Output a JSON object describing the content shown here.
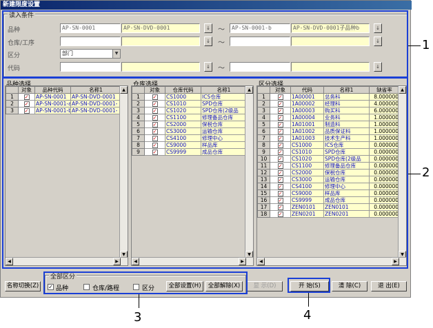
{
  "window": {
    "title": "新建限度设置"
  },
  "input_conditions": {
    "legend": "读入条件",
    "rows": [
      {
        "label": "品种",
        "from_code": "AP-SN-0001",
        "from_name": "AP-SN-DVD-0001",
        "to_code": "AP-SN-0001-b",
        "to_name": "AP-SN-DVD-0001子品种b"
      },
      {
        "label": "仓库/工序",
        "from_code": "",
        "from_name": "",
        "to_code": "",
        "to_name": ""
      },
      {
        "label": "区分",
        "select_value": "部门"
      },
      {
        "label": "代码",
        "from_code": "",
        "from_name": "",
        "to_code": "",
        "to_name": ""
      }
    ],
    "lookup_btn": "↓",
    "tilde": "～"
  },
  "panels": {
    "product": {
      "title": "品种选择",
      "headers": [
        "",
        "对象",
        "品种代码",
        "名称1"
      ],
      "rows": [
        [
          "1",
          "✓",
          "AP-SN-0001",
          "AP-SN-DVD-0001"
        ],
        [
          "2",
          "✓",
          "AP-SN-0001-a",
          "AP-SN-DVD-0001-"
        ],
        [
          "3",
          "✓",
          "AP-SN-0001-b",
          "AP-SN-DVD-0001-"
        ]
      ]
    },
    "warehouse": {
      "title": "仓库选择",
      "headers": [
        "",
        "对象",
        "仓库代码",
        "名称1"
      ],
      "rows": [
        [
          "1",
          "✓",
          "CS1000",
          "ICS仓库"
        ],
        [
          "2",
          "✓",
          "CS1010",
          "SPD仓库"
        ],
        [
          "3",
          "✓",
          "CS1020",
          "SPD仓库(2级品"
        ],
        [
          "4",
          "✓",
          "CS1100",
          "修理备品仓库"
        ],
        [
          "5",
          "✓",
          "CS2000",
          "保税仓库"
        ],
        [
          "6",
          "✓",
          "CS3000",
          "运输仓库"
        ],
        [
          "7",
          "✓",
          "CS4100",
          "修理中心"
        ],
        [
          "8",
          "✓",
          "CS9000",
          "样品库"
        ],
        [
          "9",
          "✓",
          "CS9999",
          "成品仓库"
        ]
      ]
    },
    "category": {
      "title": "区分选择",
      "headers": [
        "",
        "对象",
        "代码",
        "名称1",
        "缺省率"
      ],
      "rows": [
        [
          "1",
          "✓",
          "1A00001",
          "总务科",
          "8.000000"
        ],
        [
          "2",
          "✓",
          "1A00002",
          "经理科",
          "4.000000"
        ],
        [
          "3",
          "✓",
          "1A00003",
          "购买科",
          "6.000000"
        ],
        [
          "4",
          "✓",
          "1A00004",
          "业务科",
          "1.000000"
        ],
        [
          "5",
          "✓",
          "1A01001",
          "制造科",
          "1.000000"
        ],
        [
          "6",
          "✓",
          "1A01002",
          "品质保证科",
          "1.000000"
        ],
        [
          "7",
          "✓",
          "1A01003",
          "技术生产科",
          "1.000000"
        ],
        [
          "8",
          "✓",
          "CS1000",
          "ICS仓库",
          "0.000000"
        ],
        [
          "9",
          "✓",
          "CS1010",
          "SPD仓库",
          "0.000000"
        ],
        [
          "10",
          "✓",
          "CS1020",
          "SPD仓库(2级品",
          "0.000000"
        ],
        [
          "11",
          "✓",
          "CS1100",
          "修理备品仓库",
          "0.000000"
        ],
        [
          "12",
          "✓",
          "CS2000",
          "保税仓库",
          "0.000000"
        ],
        [
          "13",
          "✓",
          "CS3000",
          "运输仓库",
          "0.000000"
        ],
        [
          "14",
          "✓",
          "CS4100",
          "修理中心",
          "0.000000"
        ],
        [
          "15",
          "✓",
          "CS9000",
          "样品库",
          "0.000000"
        ],
        [
          "16",
          "✓",
          "CS9999",
          "成品仓库",
          "0.000000"
        ],
        [
          "17",
          "✓",
          "ZEN0101",
          "ZEN0101",
          "0.000000"
        ],
        [
          "18",
          "✓",
          "ZEN0201",
          "ZEN0201",
          "0.000000"
        ]
      ]
    }
  },
  "bottom": {
    "name_switch": "名称切换(Z)",
    "all_category_legend": "全部区分",
    "chk_product": "品种",
    "chk_product_checked": "✓",
    "chk_warehouse": "仓库/路程",
    "chk_category": "区分",
    "set_all": "全部设置(H)",
    "clear_all": "全部解除(X)",
    "display": "显 示(D)",
    "start": "开 始(S)",
    "clear": "清 除(C)",
    "exit": "退 出(E)"
  },
  "callouts": [
    "1",
    "2",
    "3",
    "4"
  ]
}
